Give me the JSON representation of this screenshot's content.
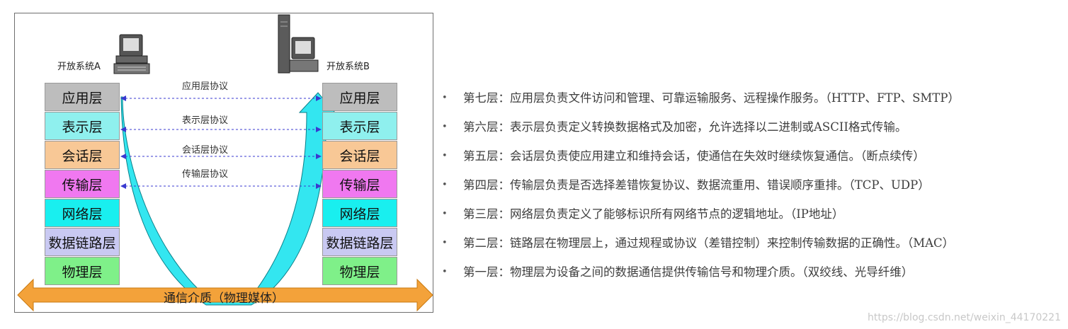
{
  "figure": {
    "system_a": "开放系统A",
    "system_b": "开放系统B",
    "layers": [
      {
        "name": "应用层",
        "color": "#bdbdbd"
      },
      {
        "name": "表示层",
        "color": "#8ff0ee"
      },
      {
        "name": "会话层",
        "color": "#f8c896"
      },
      {
        "name": "传输层",
        "color": "#f078f0"
      },
      {
        "name": "网络层",
        "color": "#19efef"
      },
      {
        "name": "数据链路层",
        "color": "#c9c9f2"
      },
      {
        "name": "物理层",
        "color": "#7ff089"
      }
    ],
    "protocols": [
      "应用层协议",
      "表示层协议",
      "会话层协议",
      "传输层协议"
    ],
    "medium": "通信介质（物理媒体）",
    "arrow_color": "#33e6f0",
    "medium_color": "#f3a23a"
  },
  "descriptions": [
    "第七层：应用层负责文件访问和管理、可靠运输服务、远程操作服务。（HTTP、FTP、SMTP）",
    "第六层：表示层负责定义转换数据格式及加密，允许选择以二进制或ASCII格式传输。",
    "第五层：会话层负责使应用建立和维持会话，使通信在失效时继续恢复通信。（断点续传）",
    "第四层：传输层负责是否选择差错恢复协议、数据流重用、错误顺序重排。（TCP、UDP）",
    "第三层：网络层负责定义了能够标识所有网络节点的逻辑地址。（IP地址）",
    "第二层：链路层在物理层上，通过规程或协议（差错控制）来控制传输数据的正确性。（MAC）",
    "第一层：物理层为设备之间的数据通信提供传输信号和物理介质。（双绞线、光导纤维）"
  ],
  "watermark": "https://blog.csdn.net/weixin_44170221"
}
